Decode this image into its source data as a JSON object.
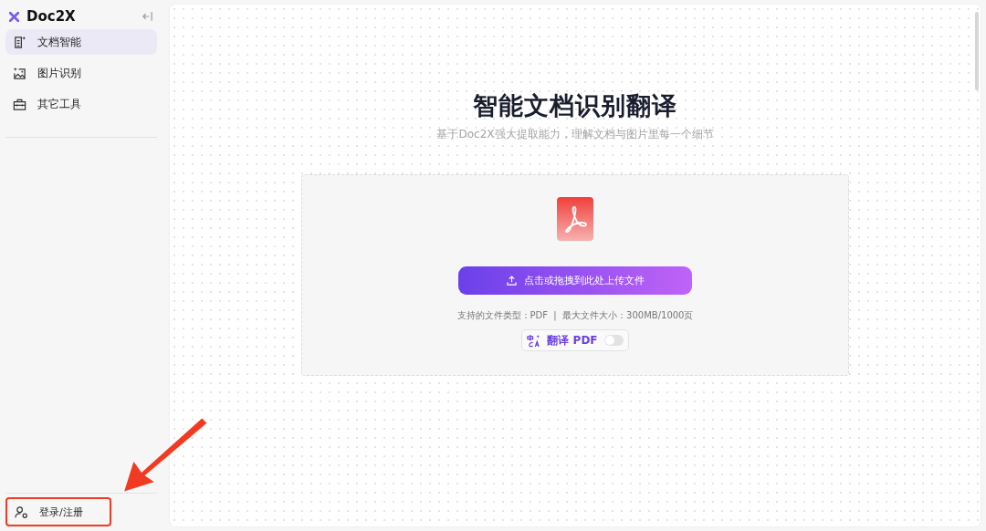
{
  "sidebar": {
    "logo": "Doc2X",
    "items": [
      {
        "label": "文档智能",
        "kind": "doc",
        "selected": true
      },
      {
        "label": "图片识别",
        "kind": "image",
        "selected": false
      },
      {
        "label": "其它工具",
        "kind": "tools",
        "selected": false
      }
    ],
    "account": {
      "label": "登录/注册",
      "highlighted": true
    }
  },
  "main": {
    "title": "智能文档识别翻译",
    "subtitle": "基于Doc2X强大提取能力，理解文档与图片里每一个细节",
    "upload": {
      "button": "点击或拖拽到此处上传文件",
      "info": "支持的文件类型：PDF  |  最大文件大小：300MB/1000页",
      "translate": {
        "label": "翻译 PDF",
        "on": false
      }
    }
  },
  "annotation": {
    "arrow": true
  }
}
